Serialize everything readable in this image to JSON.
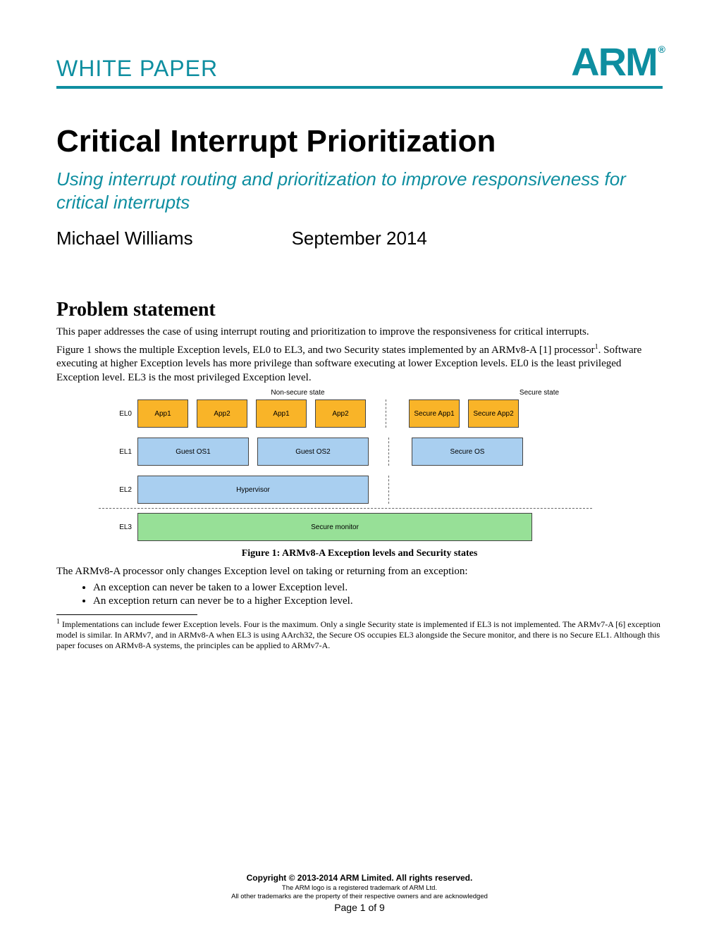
{
  "header": {
    "doctype": "WHITE PAPER",
    "logo": "ARM",
    "reg": "®"
  },
  "title": "Critical Interrupt Prioritization",
  "subtitle": "Using interrupt routing and prioritization to improve responsiveness for critical interrupts",
  "author": "Michael Williams",
  "date": "September 2014",
  "section": "Problem statement",
  "para1": "This paper addresses the case of using interrupt routing and prioritization to improve the responsiveness for critical interrupts.",
  "para2a": "Figure 1 shows the multiple Exception levels, EL0 to EL3, and two Security states implemented by an ARMv8-A [1] processor",
  "para2b": ". Software executing at higher Exception levels has more privilege than software executing at lower Exception levels. EL0 is the least privileged Exception level. EL3 is the most privileged Exception level.",
  "diagram": {
    "ns_label": "Non-secure state",
    "s_label": "Secure state",
    "rows": {
      "el0": "EL0",
      "el1": "EL1",
      "el2": "EL2",
      "el3": "EL3"
    },
    "apps": [
      "App1",
      "App2",
      "App1",
      "App2"
    ],
    "secapps": [
      "Secure App1",
      "Secure App2"
    ],
    "guests": [
      "Guest OS1",
      "Guest OS2"
    ],
    "secure_os": "Secure OS",
    "hypervisor": "Hypervisor",
    "monitor": "Secure monitor"
  },
  "caption": "Figure 1: ARMv8-A Exception levels and Security states",
  "para3": "The ARMv8-A processor only changes Exception level on taking or returning from an exception:",
  "bullets": [
    "An exception can never be taken to a lower Exception level.",
    "An exception return can never be to a higher Exception level."
  ],
  "footnote_num": "1",
  "footnote": " Implementations can include fewer Exception levels. Four is the maximum. Only a single Security state is implemented if EL3 is not implemented. The ARMv7-A [6] exception model is similar. In ARMv7, and in ARMv8-A when EL3 is using AArch32, the Secure OS occupies EL3 alongside the Secure monitor, and there is no Secure EL1. Although this paper focuses on ARMv8-A systems, the principles can be applied to ARMv7-A.",
  "footer": {
    "copyright": "Copyright © 2013-2014 ARM Limited. All rights reserved.",
    "tm1": "The ARM logo is a registered trademark of ARM Ltd.",
    "tm2": "All other trademarks are the property of their respective owners and are acknowledged",
    "page": "Page 1 of 9"
  }
}
